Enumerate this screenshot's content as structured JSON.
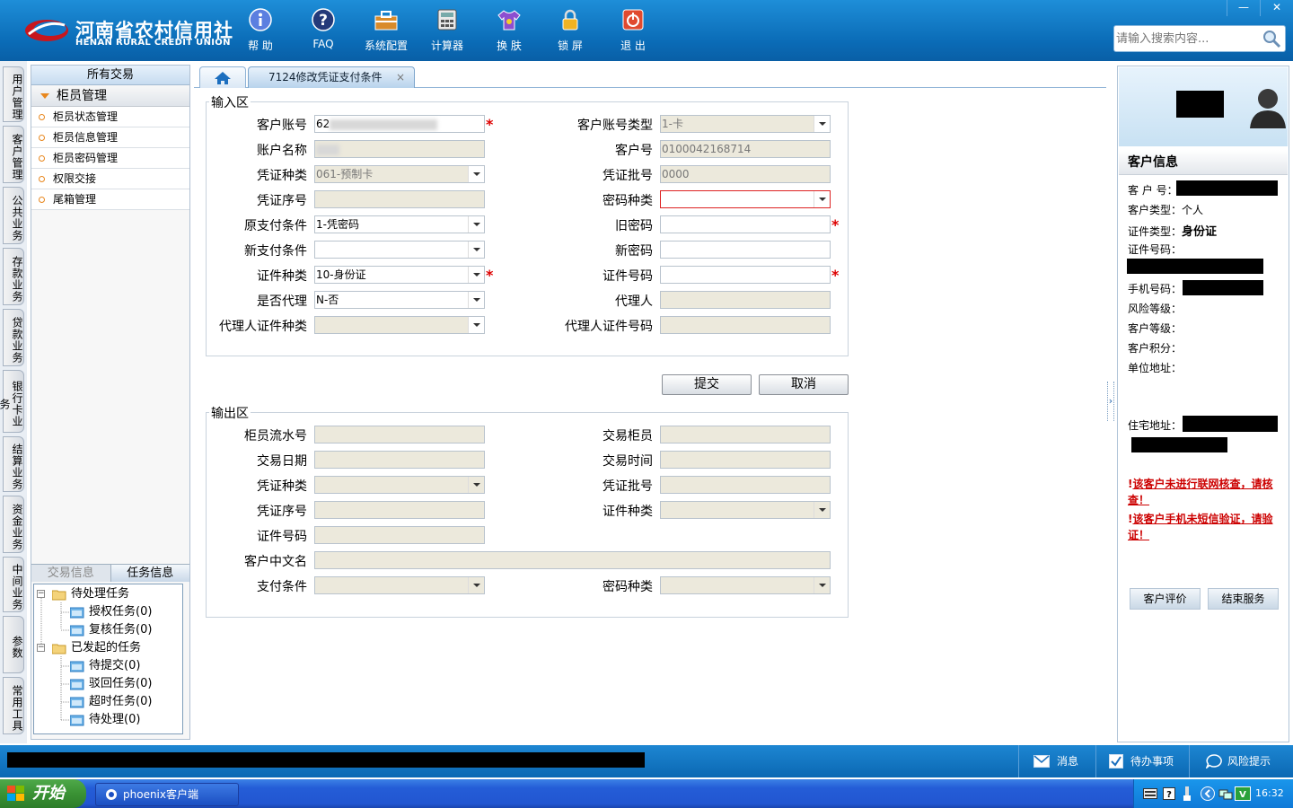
{
  "header": {
    "logo_cn": "河南省农村信用社",
    "logo_en": "HENAN RURAL CREDIT UNION",
    "toolbar": [
      {
        "label": "帮 助",
        "icon": "info-icon"
      },
      {
        "label": "FAQ",
        "icon": "question-icon"
      },
      {
        "label": "系统配置",
        "icon": "toolbox-icon"
      },
      {
        "label": "计算器",
        "icon": "calculator-icon"
      },
      {
        "label": "换 肤",
        "icon": "shirt-icon"
      },
      {
        "label": "锁 屏",
        "icon": "lock-icon"
      },
      {
        "label": "退 出",
        "icon": "power-icon"
      }
    ],
    "search_placeholder": "请输入搜索内容..."
  },
  "vtabs": [
    "用户管理",
    "客户管理",
    "公共业务",
    "存款业务",
    "贷款业务",
    "银行卡业务",
    "结算业务",
    "资金业务",
    "中间业务",
    "参数",
    "常用工具"
  ],
  "nav": {
    "header": "所有交易",
    "group": "柜员管理",
    "items": [
      "柜员状态管理",
      "柜员信息管理",
      "柜员密码管理",
      "权限交接",
      "尾箱管理"
    ],
    "bottom_tabs": [
      "交易信息",
      "任务信息"
    ],
    "tree": {
      "pending": "待处理任务",
      "auth": "授权任务(0)",
      "review": "复核任务(0)",
      "initiated": "已发起的任务",
      "to_submit": "待提交(0)",
      "rejected": "驳回任务(0)",
      "timeout": "超时任务(0)",
      "to_process": "待处理(0)"
    }
  },
  "tabs": {
    "home_icon": "home-icon",
    "active": "7124修改凭证支付条件",
    "close": "×"
  },
  "input_section": {
    "legend": "输入区",
    "labels": {
      "account_no": "客户账号",
      "account_type": "客户账号类型",
      "account_name": "账户名称",
      "customer_no": "客户号",
      "voucher_type": "凭证种类",
      "voucher_batch": "凭证批号",
      "voucher_seq": "凭证序号",
      "pwd_type": "密码种类",
      "orig_pay_cond": "原支付条件",
      "old_pwd": "旧密码",
      "new_pay_cond": "新支付条件",
      "new_pwd": "新密码",
      "id_type": "证件种类",
      "id_no": "证件号码",
      "is_agent": "是否代理",
      "agent": "代理人",
      "agent_id_type": "代理人证件种类",
      "agent_id_no": "代理人证件号码"
    },
    "values": {
      "account_no": "62",
      "account_type": "1-卡",
      "customer_no": "0100042168714",
      "voucher_type": "061-预制卡",
      "voucher_batch": "0000",
      "orig_pay_cond": "1-凭密码",
      "id_type": "10-身份证",
      "is_agent": "N-否"
    },
    "required_mark": "*",
    "submit": "提交",
    "cancel": "取消"
  },
  "output_section": {
    "legend": "输出区",
    "labels": {
      "teller_serial": "柜员流水号",
      "trans_teller": "交易柜员",
      "trans_date": "交易日期",
      "trans_time": "交易时间",
      "voucher_type": "凭证种类",
      "voucher_batch": "凭证批号",
      "voucher_seq": "凭证序号",
      "id_type": "证件种类",
      "id_no": "证件号码",
      "cn_name": "客户中文名",
      "pay_cond": "支付条件",
      "pwd_type": "密码种类"
    }
  },
  "customer_panel": {
    "title": "客户信息",
    "customer_no": "客 户 号：",
    "customer_type_label": "客户类型：",
    "customer_type": "个人",
    "id_type_label": "证件类型：",
    "id_type": "身份证",
    "id_no": "证件号码：",
    "phone": "手机号码：",
    "risk_level": "风险等级：",
    "customer_level": "客户等级：",
    "points": "客户积分：",
    "work_addr": "单位地址：",
    "home_addr": "住宅地址：",
    "warnings": [
      "该客户未进行联网核查，请核查！",
      "该客户手机未短信验证，请验证！"
    ],
    "warn_prefix": "!",
    "evaluate_btn": "客户评价",
    "end_btn": "结束服务"
  },
  "status_bar": {
    "messages": "消息",
    "todo": "待办事项",
    "risk": "风险提示"
  },
  "taskbar": {
    "start": "开始",
    "app": "phoenix客户端",
    "clock": "16:32"
  },
  "colors": {
    "header_blue": "#0a6bb6",
    "required_red": "#dd0000",
    "accent_orange": "#e8871e"
  }
}
